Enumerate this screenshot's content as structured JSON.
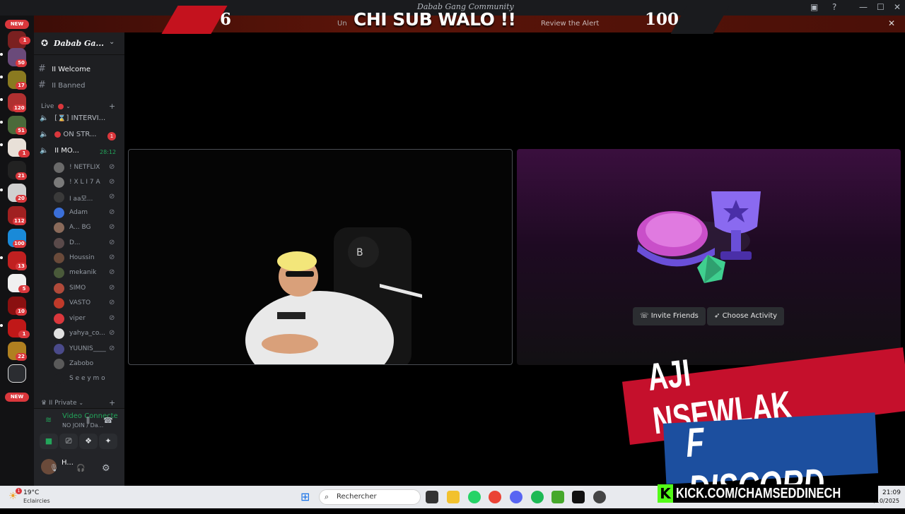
{
  "window": {
    "title": "Dabab Gang Community"
  },
  "alert_banner": {
    "left_count": "6",
    "title": "CHI SUB WALO !!",
    "subtext": "Un",
    "review_label": "Review the Alert",
    "right_count": "100"
  },
  "server_rail": {
    "top_pill": "NEW",
    "bottom_pill": "NEW",
    "badges": [
      "1",
      "50",
      "17",
      "120",
      "51",
      "1",
      "21",
      "20",
      "112",
      "100",
      "13",
      "5",
      "10",
      "1",
      "22"
    ]
  },
  "sidebar": {
    "server_name": "Dabab Ga...",
    "text_channels": [
      {
        "label": "II Welcome",
        "active": true
      },
      {
        "label": "II Banned",
        "active": false
      }
    ],
    "live_category": "Live",
    "voice_channels": [
      {
        "label": "[⌛] INTERVI...",
        "badge": ""
      },
      {
        "label": "ON STR...",
        "badge": "1"
      },
      {
        "label": "II MO...",
        "badge": "",
        "timer": "28:12"
      }
    ],
    "members": [
      {
        "name": "! NETFLIX",
        "avatar_color": "#6a6a6a"
      },
      {
        "name": "! X L I 7 A",
        "avatar_color": "#7a7a7a"
      },
      {
        "name": "I aa모...",
        "avatar_color": "#3a3a3a"
      },
      {
        "name": "Adam",
        "avatar_color": "#3b6fd8"
      },
      {
        "name": "A... BG",
        "avatar_color": "#8a6a5a"
      },
      {
        "name": "D...",
        "avatar_color": "#5a4a4a"
      },
      {
        "name": "Houssin",
        "avatar_color": "#6a4a3a"
      },
      {
        "name": "mekanik",
        "avatar_color": "#4a5a3a"
      },
      {
        "name": "SIMO",
        "avatar_color": "#b04a3a"
      },
      {
        "name": "VASTO",
        "avatar_color": "#c03a2a"
      },
      {
        "name": "viper",
        "avatar_color": "#da373c"
      },
      {
        "name": "yahya_co...",
        "avatar_color": "#e0e0e0"
      },
      {
        "name": "YUUNIS____",
        "avatar_color": "#4a4a8a"
      },
      {
        "name": "Zabobo",
        "avatar_color": "#5a5a5a"
      },
      {
        "name": "S e e y m o",
        "avatar_color": "#1e1f22"
      }
    ],
    "private_category": "II Private"
  },
  "voice_panel": {
    "status": "Video Connecte",
    "channel": "NO JOIN / Da...",
    "username": "H..."
  },
  "activity": {
    "invite_label": "Invite Friends",
    "choose_label": "Choose Activity"
  },
  "promo": {
    "line1": "AJI NSEWLAK",
    "line2": "F DISCORD",
    "kick_logo": "K",
    "kick_url": "KICK.COM/CHAMSEDDINECH"
  },
  "taskbar": {
    "weather_temp": "19°C",
    "weather_desc": "Eclaircies",
    "search_placeholder": "Rechercher",
    "time": "21:09",
    "date": "27/10/2025"
  }
}
